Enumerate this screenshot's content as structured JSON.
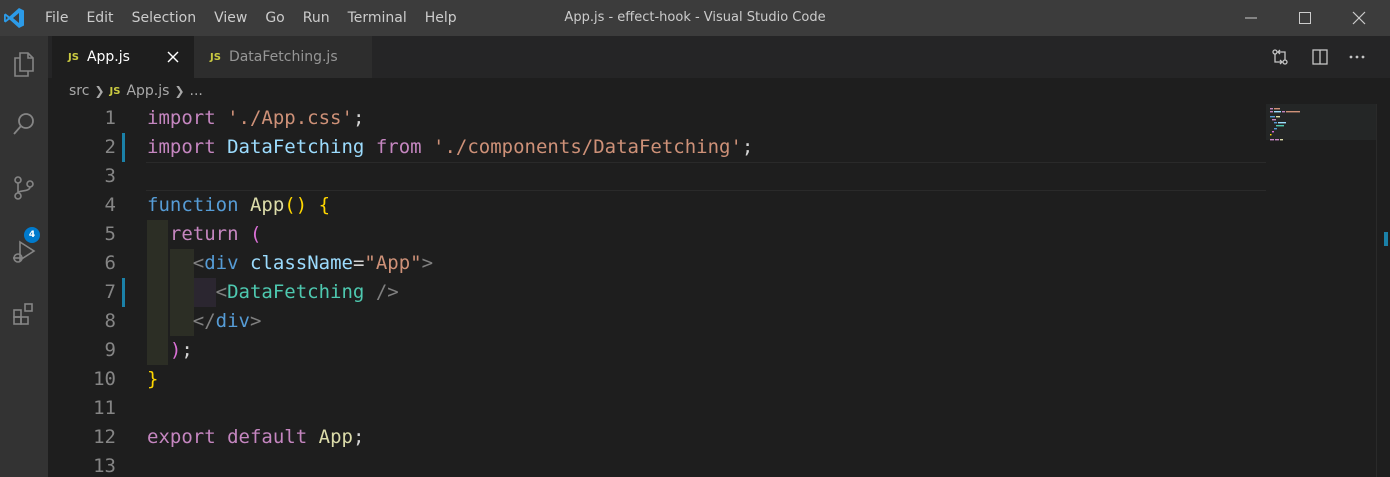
{
  "titlebar": {
    "menu": [
      "File",
      "Edit",
      "Selection",
      "View",
      "Go",
      "Run",
      "Terminal",
      "Help"
    ],
    "window_title": "App.js - effect-hook - Visual Studio Code"
  },
  "activitybar": {
    "icons": [
      "explorer-icon",
      "search-icon",
      "source-control-icon",
      "run-debug-icon",
      "extensions-icon"
    ],
    "source_control_badge": "4"
  },
  "tabs": [
    {
      "badge": "JS",
      "label": "App.js",
      "active": true
    },
    {
      "badge": "JS",
      "label": "DataFetching.js",
      "active": false
    }
  ],
  "breadcrumb": {
    "folder": "src",
    "file_badge": "JS",
    "file": "App.js",
    "trail": "..."
  },
  "editor": {
    "line_numbers": [
      "1",
      "2",
      "3",
      "4",
      "5",
      "6",
      "7",
      "8",
      "9",
      "10",
      "11",
      "12",
      "13"
    ],
    "modified_lines": [
      2,
      7
    ],
    "code": {
      "l1_kw": "import",
      "l1_str": "'./App.css'",
      "l1_end": ";",
      "l2_kw": "import",
      "l2_var": "DataFetching",
      "l2_from": "from",
      "l2_str": "'./components/DataFetching'",
      "l2_end": ";",
      "l4_kw": "function",
      "l4_fn": "App",
      "l4_paren": "()",
      "l4_brace": "{",
      "l5_kw": "return",
      "l5_paren": "(",
      "l6_open": "<",
      "l6_tag": "div",
      "l6_attr": "className",
      "l6_eq": "=",
      "l6_val": "\"App\"",
      "l6_close": ">",
      "l7_open": "<",
      "l7_comp": "DataFetching",
      "l7_close": " />",
      "l8_open": "</",
      "l8_tag": "div",
      "l8_close": ">",
      "l9_paren": ")",
      "l9_end": ";",
      "l10_brace": "}",
      "l12_kw": "export",
      "l12_kw2": "default",
      "l12_var": "App",
      "l12_end": ";"
    }
  }
}
